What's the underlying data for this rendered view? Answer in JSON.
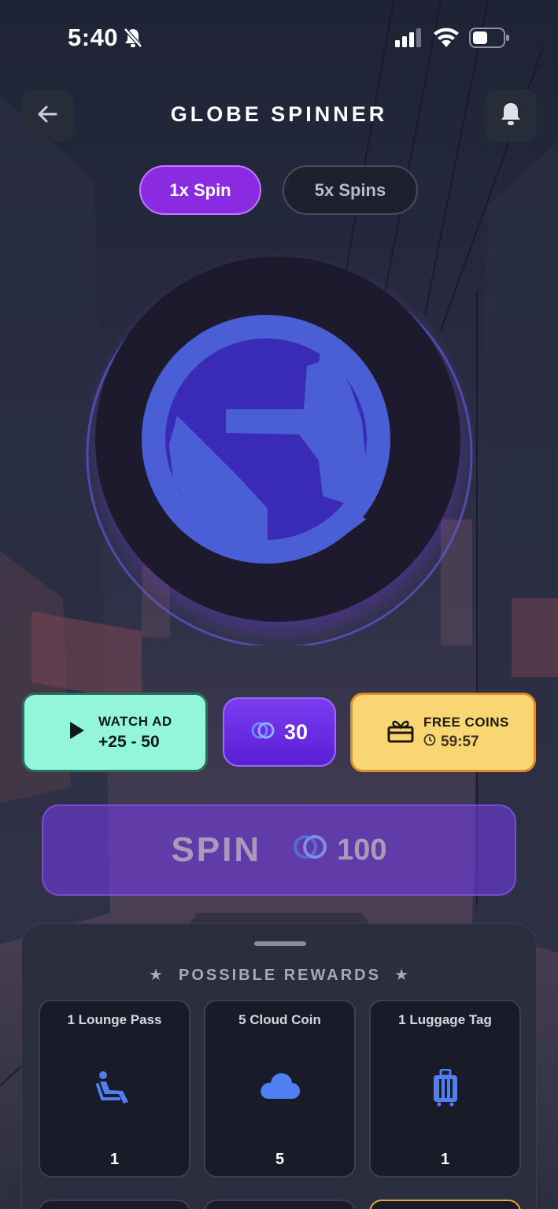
{
  "status_bar": {
    "time": "5:40"
  },
  "header": {
    "title": "GLOBE SPINNER"
  },
  "icons": {
    "back": "arrow-left-icon",
    "bell": "bell-icon",
    "mute": "bell-slash-icon"
  },
  "mode_tabs": [
    {
      "label": "1x Spin",
      "active": true
    },
    {
      "label": "5x Spins",
      "active": false
    }
  ],
  "actions": {
    "watch_ad": {
      "title": "WATCH AD",
      "reward": "+25 - 50"
    },
    "balance": {
      "value": "30"
    },
    "free_coins": {
      "title": "FREE COINS",
      "timer": "59:57"
    }
  },
  "spin": {
    "label": "SPIN",
    "cost": "100"
  },
  "rewards": {
    "title": "POSSIBLE REWARDS",
    "items": [
      {
        "name": "1 Lounge Pass",
        "icon": "airline-seat-icon",
        "qty": "1"
      },
      {
        "name": "5 Cloud Coin",
        "icon": "cloud-icon",
        "qty": "5"
      },
      {
        "name": "1 Luggage Tag",
        "icon": "luggage-icon",
        "qty": "1"
      }
    ]
  },
  "colors": {
    "accent_purple": "#8a2be2",
    "ad_green": "#93f5d9",
    "free_yellow": "#fad672",
    "icon_blue": "#4f7ff0"
  }
}
